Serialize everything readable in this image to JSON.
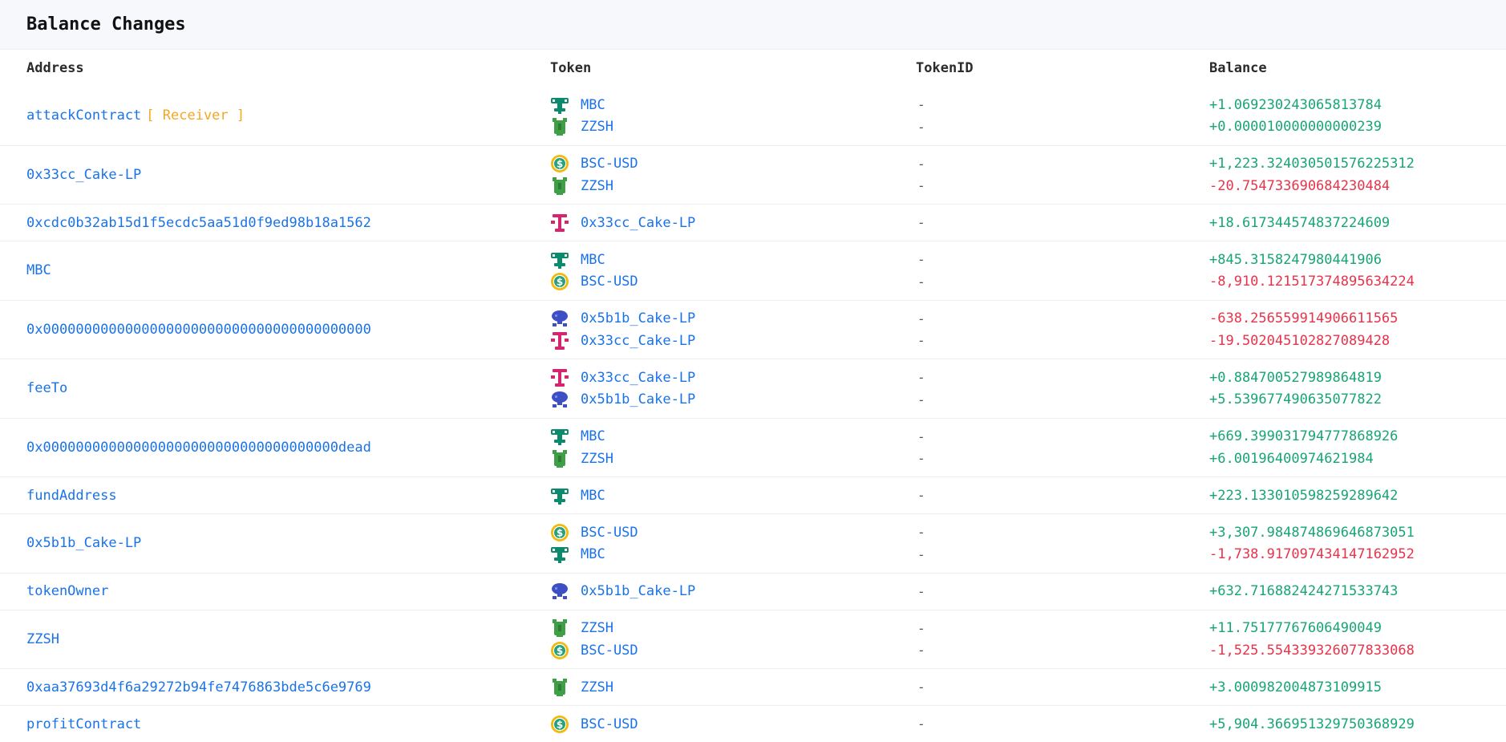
{
  "header": {
    "title": "Balance Changes"
  },
  "columns": {
    "address": "Address",
    "token": "Token",
    "token_id": "TokenID",
    "balance": "Balance"
  },
  "colors": {
    "positive": "#17a673",
    "negative": "#e8334a",
    "link": "#1a73e8",
    "receiver": "#f5a623"
  },
  "rows": [
    {
      "address": "attackContract",
      "tag": "[ Receiver ]",
      "entries": [
        {
          "token": "MBC",
          "icon": "mbc-icon",
          "token_id": "-",
          "balance": "+1.069230243065813784",
          "sign": "pos"
        },
        {
          "token": "ZZSH",
          "icon": "zzsh-icon",
          "token_id": "-",
          "balance": "+0.000010000000000239",
          "sign": "pos"
        }
      ]
    },
    {
      "address": "0x33cc_Cake-LP",
      "entries": [
        {
          "token": "BSC-USD",
          "icon": "bsc-usd-icon",
          "token_id": "-",
          "balance": "+1,223.324030501576225312",
          "sign": "pos"
        },
        {
          "token": "ZZSH",
          "icon": "zzsh-icon",
          "token_id": "-",
          "balance": "-20.754733690684230484",
          "sign": "neg"
        }
      ]
    },
    {
      "address": "0xcdc0b32ab15d1f5ecdc5aa51d0f9ed98b18a1562",
      "entries": [
        {
          "token": "0x33cc_Cake-LP",
          "icon": "cake-lp-33cc-icon",
          "token_id": "-",
          "balance": "+18.617344574837224609",
          "sign": "pos"
        }
      ]
    },
    {
      "address": "MBC",
      "entries": [
        {
          "token": "MBC",
          "icon": "mbc-icon",
          "token_id": "-",
          "balance": "+845.3158247980441906",
          "sign": "pos"
        },
        {
          "token": "BSC-USD",
          "icon": "bsc-usd-icon",
          "token_id": "-",
          "balance": "-8,910.121517374895634224",
          "sign": "neg"
        }
      ]
    },
    {
      "address": "0x0000000000000000000000000000000000000000",
      "entries": [
        {
          "token": "0x5b1b_Cake-LP",
          "icon": "cake-lp-5b1b-icon",
          "token_id": "-",
          "balance": "-638.256559914906611565",
          "sign": "neg"
        },
        {
          "token": "0x33cc_Cake-LP",
          "icon": "cake-lp-33cc-icon",
          "token_id": "-",
          "balance": "-19.502045102827089428",
          "sign": "neg"
        }
      ]
    },
    {
      "address": "feeTo",
      "entries": [
        {
          "token": "0x33cc_Cake-LP",
          "icon": "cake-lp-33cc-icon",
          "token_id": "-",
          "balance": "+0.884700527989864819",
          "sign": "pos"
        },
        {
          "token": "0x5b1b_Cake-LP",
          "icon": "cake-lp-5b1b-icon",
          "token_id": "-",
          "balance": "+5.539677490635077822",
          "sign": "pos"
        }
      ]
    },
    {
      "address": "0x000000000000000000000000000000000000dead",
      "entries": [
        {
          "token": "MBC",
          "icon": "mbc-icon",
          "token_id": "-",
          "balance": "+669.399031794777868926",
          "sign": "pos"
        },
        {
          "token": "ZZSH",
          "icon": "zzsh-icon",
          "token_id": "-",
          "balance": "+6.00196400974621984",
          "sign": "pos"
        }
      ]
    },
    {
      "address": "fundAddress",
      "entries": [
        {
          "token": "MBC",
          "icon": "mbc-icon",
          "token_id": "-",
          "balance": "+223.133010598259289642",
          "sign": "pos"
        }
      ]
    },
    {
      "address": "0x5b1b_Cake-LP",
      "entries": [
        {
          "token": "BSC-USD",
          "icon": "bsc-usd-icon",
          "token_id": "-",
          "balance": "+3,307.984874869646873051",
          "sign": "pos"
        },
        {
          "token": "MBC",
          "icon": "mbc-icon",
          "token_id": "-",
          "balance": "-1,738.917097434147162952",
          "sign": "neg"
        }
      ]
    },
    {
      "address": "tokenOwner",
      "entries": [
        {
          "token": "0x5b1b_Cake-LP",
          "icon": "cake-lp-5b1b-icon",
          "token_id": "-",
          "balance": "+632.716882424271533743",
          "sign": "pos"
        }
      ]
    },
    {
      "address": "ZZSH",
      "entries": [
        {
          "token": "ZZSH",
          "icon": "zzsh-icon",
          "token_id": "-",
          "balance": "+11.75177767606490049",
          "sign": "pos"
        },
        {
          "token": "BSC-USD",
          "icon": "bsc-usd-icon",
          "token_id": "-",
          "balance": "-1,525.554339326077833068",
          "sign": "neg"
        }
      ]
    },
    {
      "address": "0xaa37693d4f6a29272b94fe7476863bde5c6e9769",
      "entries": [
        {
          "token": "ZZSH",
          "icon": "zzsh-icon",
          "token_id": "-",
          "balance": "+3.000982004873109915",
          "sign": "pos"
        }
      ]
    },
    {
      "address": "profitContract",
      "entries": [
        {
          "token": "BSC-USD",
          "icon": "bsc-usd-icon",
          "token_id": "-",
          "balance": "+5,904.366951329750368929",
          "sign": "pos"
        }
      ]
    }
  ]
}
